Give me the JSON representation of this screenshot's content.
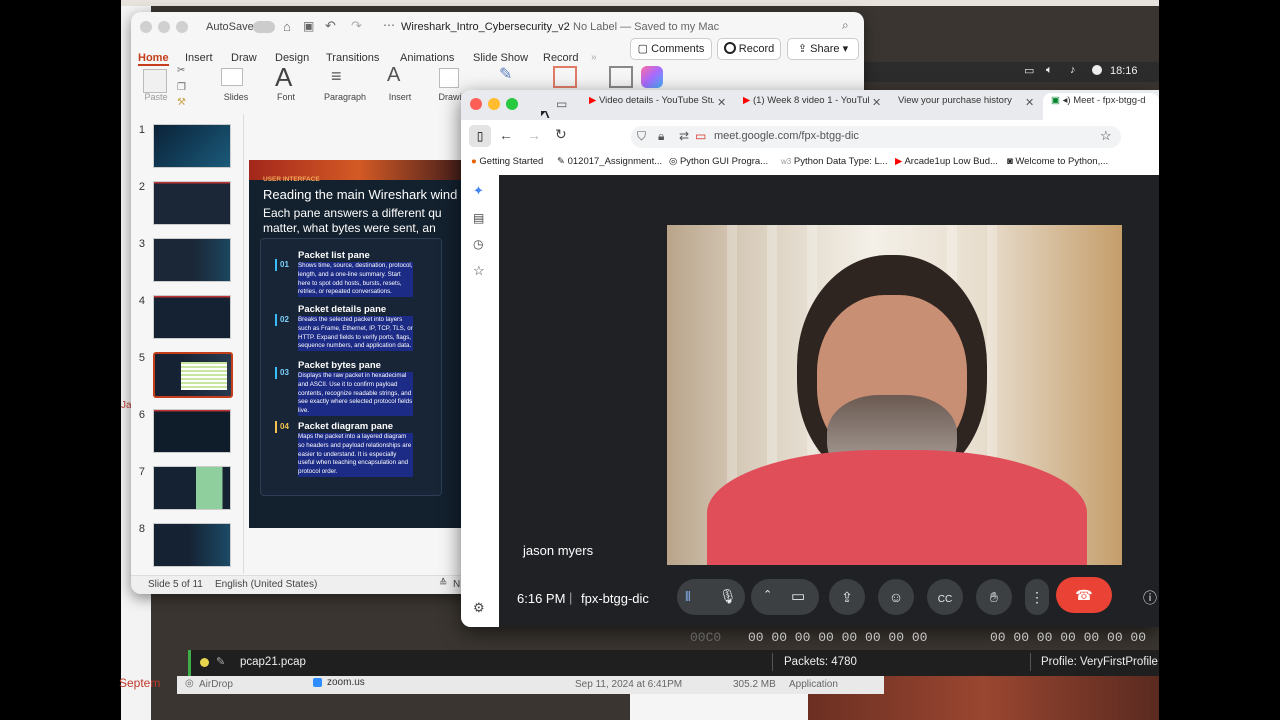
{
  "powerpoint": {
    "autosave_label": "AutoSave",
    "filename": "Wireshark_Intro_Cybersecurity_v2",
    "save_status": "No Label — Saved to my Mac",
    "ribbon_tabs": [
      "Home",
      "Insert",
      "Draw",
      "Design",
      "Transitions",
      "Animations",
      "Slide Show",
      "Record"
    ],
    "comments_label": "Comments",
    "record_label": "Record",
    "share_label": "Share",
    "ribbon_buttons": {
      "paste": "Paste",
      "slides": "Slides",
      "font": "Font",
      "paragraph": "Paragraph",
      "insert": "Insert",
      "draw": "Drawi"
    },
    "thumbnails": [
      "1",
      "2",
      "3",
      "4",
      "5",
      "6",
      "7",
      "8"
    ],
    "selected_slide": 5,
    "slide": {
      "kicker": "USER INTERFACE",
      "title": "Reading the main Wireshark wind",
      "subtitle_line1": "Each pane answers a different qu",
      "subtitle_line2": "matter, what bytes were sent, an",
      "panes": [
        {
          "num": "01",
          "title": "Packet list pane",
          "body": "Shows time, source, destination, protocol, length, and a one-line summary. Start here to spot odd hosts, bursts, resets, retries, or repeated conversations."
        },
        {
          "num": "02",
          "title": "Packet details pane",
          "body": "Breaks the selected packet into layers such as Frame, Ethernet, IP, TCP, TLS, or HTTP. Expand fields to verify ports, flags, sequence numbers, and application data."
        },
        {
          "num": "03",
          "title": "Packet bytes pane",
          "body": "Displays the raw packet in hexadecimal and ASCII. Use it to confirm payload contents, recognize readable strings, and see exactly where selected protocol fields live."
        },
        {
          "num": "04",
          "title": "Packet diagram pane",
          "body": "Maps the packet into a layered diagram so headers and payload relationships are easier to understand. It is especially useful when teaching encapsulation and protocol order."
        }
      ]
    },
    "status_slide": "Slide 5 of 11",
    "status_language": "English (United States)",
    "status_notes": "N"
  },
  "mac_status": {
    "time": "18:16"
  },
  "chrome": {
    "tabs": [
      {
        "label": "Video details - YouTube Stu",
        "icon": "youtube-icon"
      },
      {
        "label": "(1) Week 8 video 1 - YouTub",
        "icon": "youtube-icon"
      },
      {
        "label": "View your purchase history",
        "icon": "apple-icon"
      },
      {
        "label": "Meet - fpx-btgg-d",
        "icon": "meet-icon"
      }
    ],
    "url": "meet.google.com/fpx-btgg-dic",
    "bookmarks": [
      "Getting Started",
      "012017_Assignment...",
      "Python GUI Progra...",
      "Python Data Type: L...",
      "Arcade1up Low Bud...",
      "Welcome to Python,..."
    ]
  },
  "meet": {
    "participant_name": "jason myers",
    "time": "6:16 PM",
    "separator": "|",
    "meeting_code": "fpx-btgg-dic"
  },
  "wireshark": {
    "hex_offset": "00C0",
    "hex_bytes_a": "00 00 00 00 00 00 00 00",
    "hex_bytes_b": "00 00 00 00 00 00 00",
    "file": "pcap21.pcap",
    "packets": "Packets: 4780",
    "profile": "Profile: VeryFirstProfile"
  },
  "finder": {
    "airdrop": "AirDrop",
    "app": "zoom.us",
    "date": "Sep 11, 2024 at 6:41PM",
    "size": "305.2 MB",
    "kind": "Application"
  },
  "background": {
    "calendar_month": "Septem"
  },
  "colors": {
    "ppt_accent": "#c43e1c",
    "meet_bg": "#202124",
    "end_call": "#ea4335"
  }
}
